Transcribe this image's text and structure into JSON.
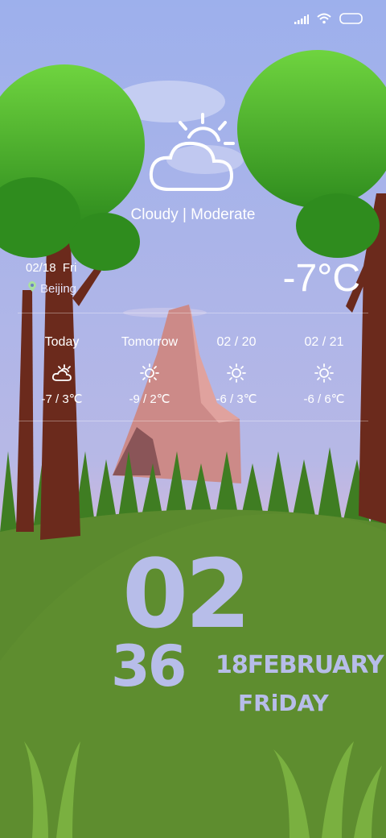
{
  "status_bar": {
    "signal_icon": "signal-icon",
    "wifi_icon": "wifi-icon",
    "battery_icon": "battery-icon"
  },
  "weather": {
    "condition": "Cloudy | Moderate",
    "date": "02/18  Fri",
    "location": "Beijing",
    "temperature": "-7°C",
    "main_icon": "cloudy-sun-icon"
  },
  "forecast": [
    {
      "day": "Today",
      "range": "-7 / 3℃",
      "icon": "cloudy-sun-icon"
    },
    {
      "day": "Tomorrow",
      "range": "-9 / 2℃",
      "icon": "sun-icon"
    },
    {
      "day": "02 / 20",
      "range": "-6 / 3℃",
      "icon": "sun-icon"
    },
    {
      "day": "02 / 21",
      "range": "-6 / 6℃",
      "icon": "sun-icon"
    }
  ],
  "clock": {
    "hour": "02",
    "minute": "36",
    "date": "18FEBRUARY",
    "weekday": "FRiDAY"
  },
  "colors": {
    "sky_top": "#9db0ec",
    "sky_bottom": "#c9b8df",
    "grass": "#5b8a2e",
    "clock_text": "#b7bde9",
    "trunk": "#6b2a1c",
    "foliage": "#3fae25"
  }
}
